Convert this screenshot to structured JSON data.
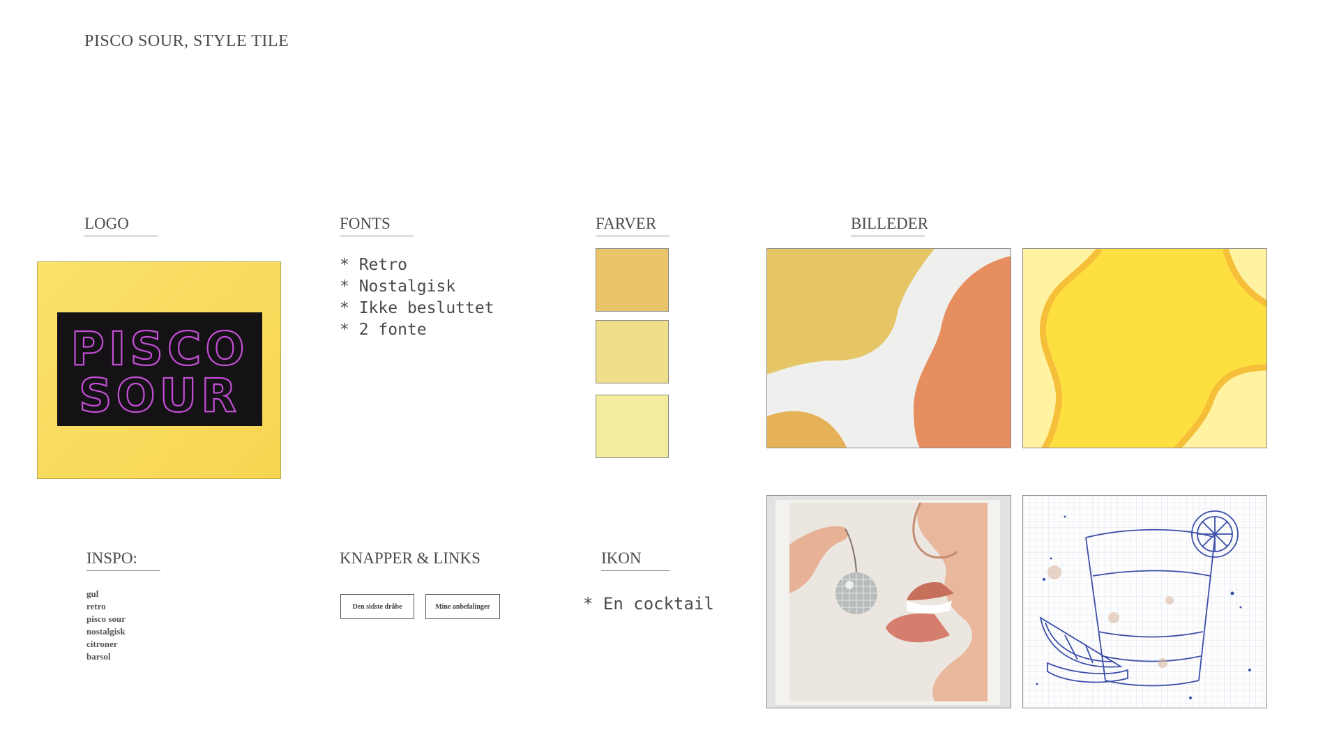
{
  "page": {
    "title": "PISCO SOUR, STYLE TILE"
  },
  "sections": {
    "logo": "LOGO",
    "fonts": "FONTS",
    "farver": "FARVER",
    "billeder": "BILLEDER",
    "inspo": "INSPO:",
    "knapper": "KNAPPER & LINKS",
    "ikon": "IKON"
  },
  "logo": {
    "line1": "PISCO",
    "line2": "SOUR"
  },
  "fonts": {
    "items": [
      "Retro",
      "Nostalgisk",
      "Ikke besluttet",
      "2 fonte"
    ]
  },
  "colors": {
    "swatches": [
      "#e9c468",
      "#efde8a",
      "#f4ec9e"
    ],
    "logo_text": "#c44fd6",
    "logo_plate": "#141214"
  },
  "inspo": {
    "items": [
      "gul",
      "retro",
      "pisco sour",
      "nostalgisk",
      "citroner",
      "barsol"
    ]
  },
  "buttons": {
    "primary": "Den sidste dråbe",
    "secondary": "Mine anbefalinger"
  },
  "icon": {
    "item": "* En cocktail"
  },
  "icons": [
    "cocktail-icon"
  ]
}
